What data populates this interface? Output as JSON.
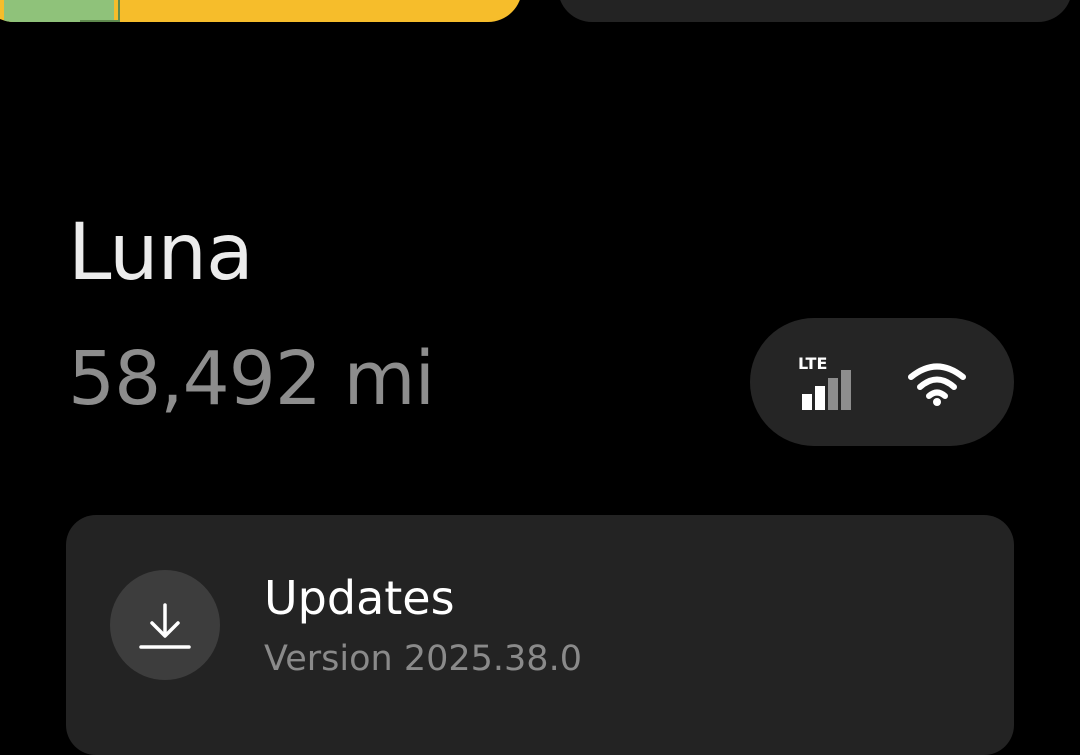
{
  "vehicle": {
    "name": "Luna",
    "odometer": "58,492 mi"
  },
  "connectivity": {
    "lte_label": "LTE",
    "lte_signal_bars": 2,
    "lte_signal_max": 4,
    "wifi_icon": "wifi-icon",
    "cellular_icon": "cellular-signal-icon"
  },
  "updates": {
    "title": "Updates",
    "version": "Version 2025.38.0",
    "icon": "download-icon"
  },
  "colors": {
    "background": "#000000",
    "card": "#232323",
    "accent_map_card": "#f6bd2b",
    "muted_text": "#8d8d8d"
  }
}
